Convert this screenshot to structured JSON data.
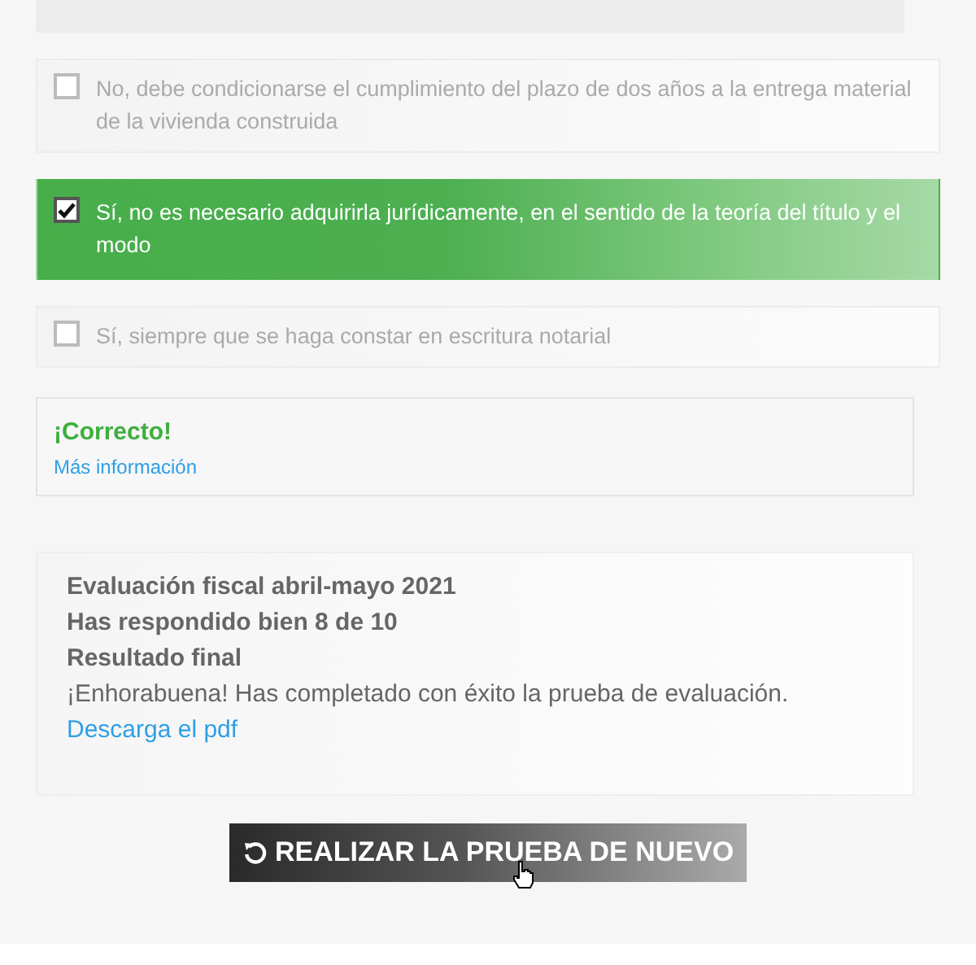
{
  "options": [
    {
      "text": "No, debe condicionarse el cumplimiento del plazo de dos años a la entrega material de la vivienda construida",
      "checked": false
    },
    {
      "text": "Sí, no es necesario adquirirla jurídicamente, en el sentido de la teoría del título y el modo",
      "checked": true
    },
    {
      "text": "Sí, siempre que se haga constar en escritura notarial",
      "checked": false
    }
  ],
  "feedback": {
    "verdict": "¡Correcto!",
    "link": "Más información"
  },
  "result": {
    "lines": [
      "Evaluación fiscal abril-mayo 2021",
      "Has respondido bien 8 de 10",
      "Resultado final"
    ],
    "message": "¡Enhorabuena! Has completado con éxito la prueba de evaluación.",
    "link": "Descarga el pdf"
  },
  "retry_button": "REALIZAR LA PRUEBA DE NUEVO"
}
